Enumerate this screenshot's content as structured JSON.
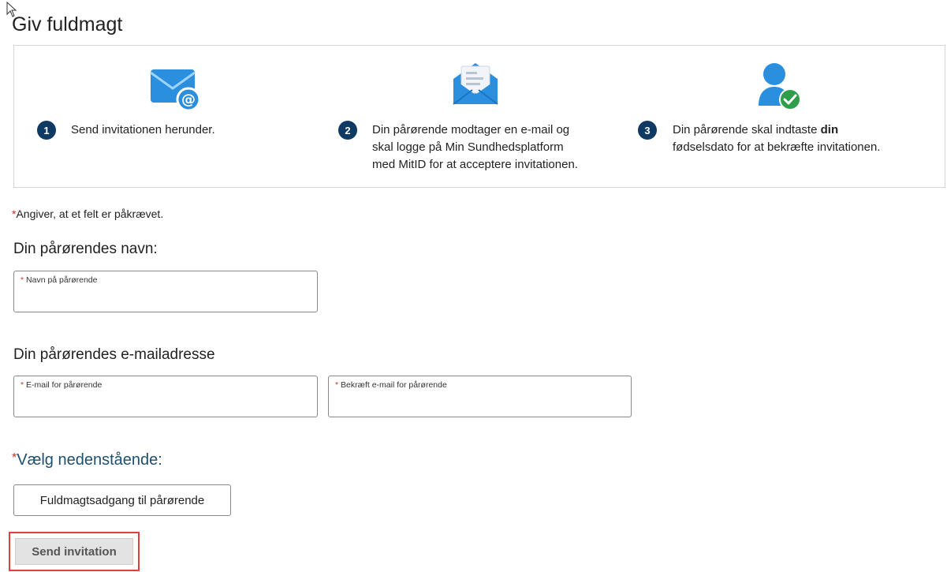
{
  "page": {
    "title": "Giv fuldmagt"
  },
  "steps": [
    {
      "number": "1",
      "icon": "mail-at-icon",
      "text_lines": [
        "Send invitationen herunder."
      ]
    },
    {
      "number": "2",
      "icon": "open-envelope-icon",
      "text_lines": [
        "Din pårørende modtager en e-mail og",
        "skal logge på Min Sundhedsplatform",
        "med MitID for at acceptere invitationen."
      ]
    },
    {
      "number": "3",
      "icon": "user-check-icon",
      "text_line1_pre": "Din pårørende skal indtaste ",
      "text_line1_bold": "din",
      "text_line2": "fødselsdato for at bekræfte invitationen."
    }
  ],
  "required_note": {
    "star": "*",
    "text": "Angiver, at et felt er påkrævet."
  },
  "name_section": {
    "heading": "Din pårørendes navn:",
    "field": {
      "star": "*",
      "label": "Navn på pårørende",
      "value": ""
    }
  },
  "email_section": {
    "heading": "Din pårørendes e-mailadresse",
    "email_field": {
      "star": "*",
      "label": "E-mail for pårørende",
      "value": ""
    },
    "confirm_field": {
      "star": "*",
      "label": "Bekræft e-mail for pårørende",
      "value": ""
    }
  },
  "choose": {
    "star": "*",
    "label": "Vælg nedenstående:",
    "option": "Fuldmagtsadgang til pårørende"
  },
  "actions": {
    "send_label": "Send invitation"
  },
  "colors": {
    "accent": "#0e3a63",
    "required": "#c0392b",
    "highlight": "#e0403a",
    "icon_blue": "#2b8fe0"
  }
}
